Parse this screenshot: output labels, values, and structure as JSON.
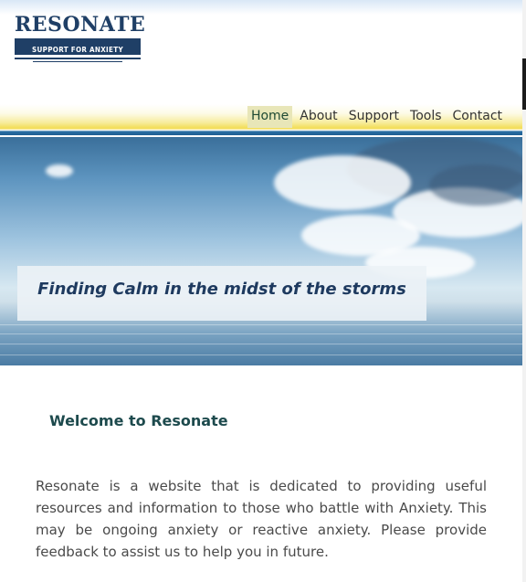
{
  "brand": {
    "logo_text": "RESONATE",
    "logo_subtitle": "SUPPORT FOR ANXIETY"
  },
  "nav": {
    "items": [
      {
        "label": "Home",
        "active": true
      },
      {
        "label": "About",
        "active": false
      },
      {
        "label": "Support",
        "active": false
      },
      {
        "label": "Tools",
        "active": false
      },
      {
        "label": "Contact",
        "active": false
      }
    ]
  },
  "hero": {
    "tagline": "Finding Calm in the midst of the storms"
  },
  "main": {
    "heading": "Welcome to Resonate",
    "intro": "Resonate is a website that is dedicated to providing useful resources and information to those who battle with Anxiety. This may be ongoing anxiety or reactive anxiety. Please provide feedback to assist us to help you in future."
  },
  "colors": {
    "brand_navy": "#1f3f66",
    "heading_teal": "#1d4a4d",
    "nav_active_bg": "#e8e6b8",
    "nav_gold": "#f2dc53"
  }
}
